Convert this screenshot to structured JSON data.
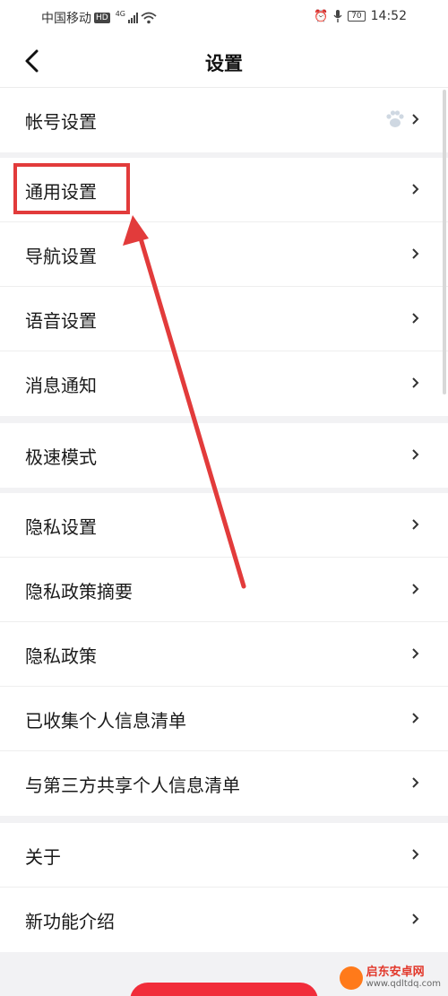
{
  "status_bar": {
    "carrier": "中国移动",
    "hd_badge": "HD",
    "network": "4G",
    "battery": "70",
    "time": "14:52"
  },
  "header": {
    "title": "设置"
  },
  "sections": [
    {
      "items": [
        {
          "label": "帐号设置",
          "icon": "paw-icon"
        }
      ]
    },
    {
      "items": [
        {
          "label": "通用设置"
        },
        {
          "label": "导航设置"
        },
        {
          "label": "语音设置"
        },
        {
          "label": "消息通知"
        }
      ]
    },
    {
      "items": [
        {
          "label": "极速模式"
        }
      ]
    },
    {
      "items": [
        {
          "label": "隐私设置"
        },
        {
          "label": "隐私政策摘要"
        },
        {
          "label": "隐私政策"
        },
        {
          "label": "已收集个人信息清单"
        },
        {
          "label": "与第三方共享个人信息清单"
        }
      ]
    },
    {
      "items": [
        {
          "label": "关于"
        },
        {
          "label": "新功能介绍"
        }
      ]
    }
  ],
  "annotation": {
    "highlight_color": "#e23b3b"
  },
  "watermark": {
    "title": "启东安卓网",
    "url": "www.qdltdq.com"
  },
  "colors": {
    "accent": "#f12d3a",
    "background": "#f2f2f4"
  }
}
